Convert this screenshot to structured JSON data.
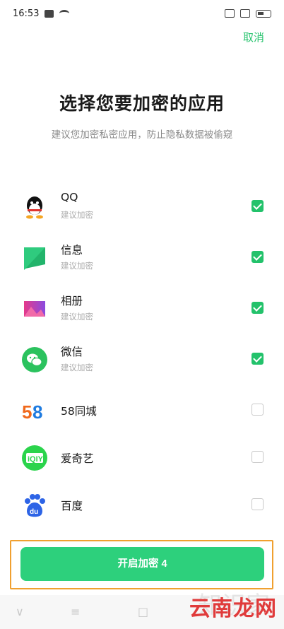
{
  "status_bar": {
    "time": "16:53"
  },
  "header": {
    "cancel_label": "取消"
  },
  "main": {
    "title": "选择您要加密的应用",
    "subtitle": "建议您加密私密应用，防止隐私数据被偷窥"
  },
  "apps": [
    {
      "name": "QQ",
      "sub": "建议加密",
      "checked": true,
      "icon": "qq-icon"
    },
    {
      "name": "信息",
      "sub": "建议加密",
      "checked": true,
      "icon": "messages-icon"
    },
    {
      "name": "相册",
      "sub": "建议加密",
      "checked": true,
      "icon": "photos-icon"
    },
    {
      "name": "微信",
      "sub": "建议加密",
      "checked": true,
      "icon": "wechat-icon"
    },
    {
      "name": "58同城",
      "checked": false,
      "icon": "58-icon"
    },
    {
      "name": "爱奇艺",
      "checked": false,
      "icon": "iqiyi-icon"
    },
    {
      "name": "百度",
      "checked": false,
      "icon": "baidu-icon"
    }
  ],
  "footer": {
    "button_label": "开启加密 4"
  },
  "nav": {
    "back": "∨",
    "home": "≡",
    "recent": "□"
  },
  "watermark": {
    "text": "云南龙网",
    "ghost": "知识家"
  },
  "colors": {
    "accent": "#23c26b",
    "button": "#2dd07c",
    "highlight": "#f0a030"
  }
}
